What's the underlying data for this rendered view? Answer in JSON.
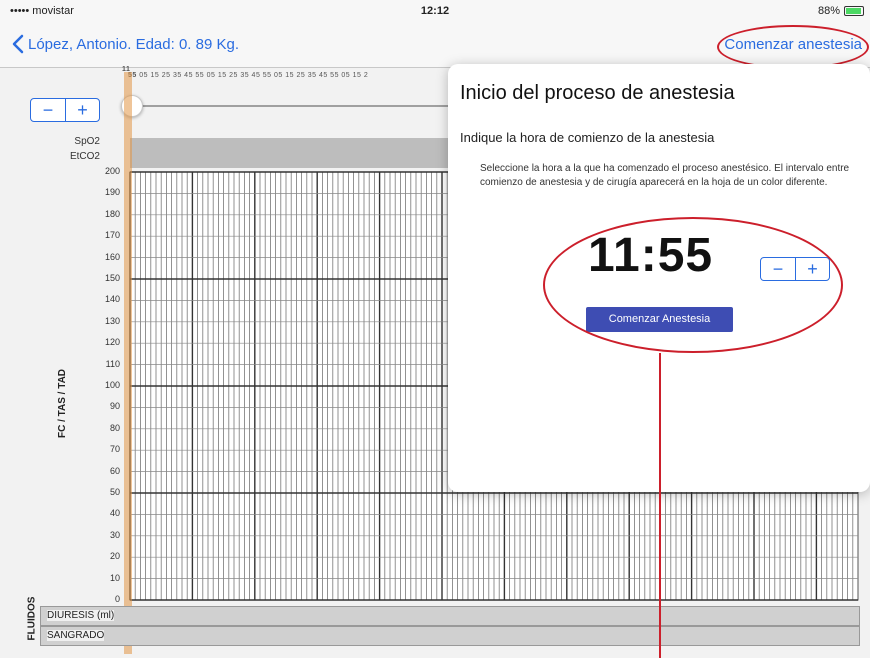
{
  "status_bar": {
    "carrier": "••••• movistar",
    "time": "12:12",
    "battery": "88%"
  },
  "nav": {
    "back_label": "López, Antonio. Edad: 0. 89 Kg.",
    "action_label": "Comenzar anestesia"
  },
  "chart": {
    "timeline": {
      "hour": "11",
      "start_minute": "55",
      "minute_ticks": "05 15 25 35 45 55 05 15 25 35 45 55 05 15 25 35 45 55 05 15 2"
    },
    "stepper": {
      "minus": "−",
      "plus": "+"
    },
    "param_labels": {
      "spo2": "SpO2",
      "etco2": "EtCO2"
    },
    "y_axis_title": "FC / TAS / TAD",
    "y_ticks": [
      "200",
      "190",
      "180",
      "170",
      "160",
      "150",
      "140",
      "130",
      "120",
      "110",
      "100",
      "90",
      "80",
      "70",
      "60",
      "50",
      "40",
      "30",
      "20",
      "10",
      "0"
    ]
  },
  "fluids": {
    "title": "FLUIDOS",
    "diuresis_label": "DIURESIS (ml)",
    "sangrado_label": "SANGRADO"
  },
  "popover": {
    "title": "Inicio del proceso de anestesia",
    "subtitle": "Indique la hora de comienzo de la anestesia",
    "description": "Seleccione la hora a la que ha comenzado el proceso anestésico. El intervalo entre comienzo de anestesia y de cirugía aparecerá en la hoja de un color diferente.",
    "time": "11:55",
    "stepper": {
      "minus": "−",
      "plus": "+"
    },
    "button_label": "Comenzar Anestesia"
  },
  "colors": {
    "accent": "#2a6ce0",
    "annotation": "#cc1f2b",
    "button": "#3e4db3"
  }
}
